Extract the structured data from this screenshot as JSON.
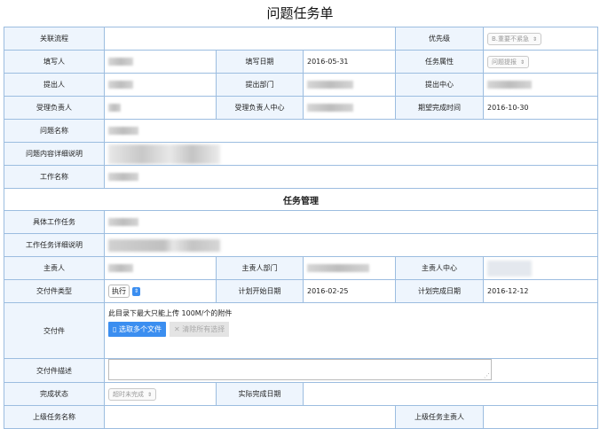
{
  "page_title": "问题任务单",
  "section_title": "任务管理",
  "labels": {
    "related_flow": "关联流程",
    "priority": "优先级",
    "filler": "填写人",
    "fill_date": "填写日期",
    "task_attr": "任务属性",
    "proposer": "提出人",
    "proposer_dept": "提出部门",
    "proposer_center": "提出中心",
    "handler": "受理负责人",
    "handler_center": "受理负责人中心",
    "expected_date": "期望完成时间",
    "problem_name": "问题名称",
    "problem_desc": "问题内容详细说明",
    "work_name": "工作名称",
    "specific_task": "具体工作任务",
    "task_desc": "工作任务详细说明",
    "owner": "主责人",
    "owner_dept": "主责人部门",
    "owner_center": "主责人中心",
    "deliverable_type": "交付件类型",
    "plan_start": "计划开始日期",
    "plan_end": "计划完成日期",
    "deliverable": "交付件",
    "deliverable_desc": "交付件描述",
    "status": "完成状态",
    "actual_date": "实际完成日期",
    "parent_task": "上级任务名称",
    "parent_owner": "上级任务主责人"
  },
  "values": {
    "priority": "B.重要不紧急",
    "fill_date": "2016-05-31",
    "task_attr": "问题提报",
    "expected_date": "2016-10-30",
    "deliverable_type": "执行",
    "plan_start": "2016-02-25",
    "plan_end": "2016-12-12",
    "upload_hint": "此目录下最大只能上传 100M/个的附件",
    "upload_button": "选取多个文件",
    "clear_button": "清除所有选择",
    "status": "超时未完成"
  },
  "icons": {
    "select_arrow": "updown-chevron-icon",
    "file_icon": "document-icon",
    "clear_icon": "x-icon"
  },
  "colors": {
    "border": "#9cbde0",
    "label_bg": "#eef5fd",
    "accent": "#3b8ef0"
  }
}
